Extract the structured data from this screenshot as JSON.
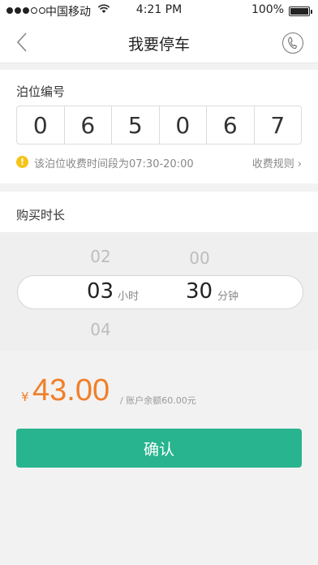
{
  "status_bar": {
    "carrier": "中国移动",
    "time": "4:21 PM",
    "battery": "100%",
    "battery_level": 1.0
  },
  "nav": {
    "title": "我要停车",
    "back_icon": "chevron-left-icon",
    "phone_icon": "phone-icon"
  },
  "parking": {
    "label": "泊位编号",
    "digits": [
      "0",
      "6",
      "5",
      "0",
      "6",
      "7"
    ],
    "notice": "该泊位收费时间段为07:30-20:00",
    "rules_link": "收费规则",
    "rules_chevron": "›"
  },
  "duration": {
    "label": "购买时长",
    "hours_prev": "02",
    "hours_selected": "03",
    "hours_next": "04",
    "hours_unit": "小时",
    "minutes_prev": "00",
    "minutes_selected": "30",
    "minutes_unit": "分钟"
  },
  "price": {
    "currency": "¥",
    "amount": "43.00",
    "balance": "/ 账户余额60.00元"
  },
  "confirm_label": "确认",
  "colors": {
    "accent": "#27b48f",
    "price": "#f07f2a",
    "warning": "#f5c419"
  }
}
